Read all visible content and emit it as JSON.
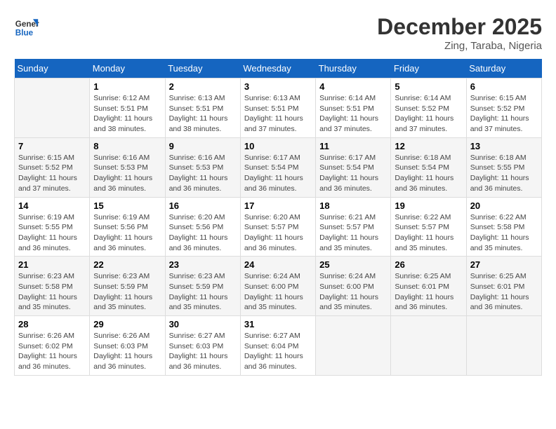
{
  "header": {
    "logo_general": "General",
    "logo_blue": "Blue",
    "title": "December 2025",
    "subtitle": "Zing, Taraba, Nigeria"
  },
  "calendar": {
    "days_of_week": [
      "Sunday",
      "Monday",
      "Tuesday",
      "Wednesday",
      "Thursday",
      "Friday",
      "Saturday"
    ],
    "weeks": [
      [
        {
          "day": "",
          "info": ""
        },
        {
          "day": "1",
          "info": "Sunrise: 6:12 AM\nSunset: 5:51 PM\nDaylight: 11 hours and 38 minutes."
        },
        {
          "day": "2",
          "info": "Sunrise: 6:13 AM\nSunset: 5:51 PM\nDaylight: 11 hours and 38 minutes."
        },
        {
          "day": "3",
          "info": "Sunrise: 6:13 AM\nSunset: 5:51 PM\nDaylight: 11 hours and 37 minutes."
        },
        {
          "day": "4",
          "info": "Sunrise: 6:14 AM\nSunset: 5:51 PM\nDaylight: 11 hours and 37 minutes."
        },
        {
          "day": "5",
          "info": "Sunrise: 6:14 AM\nSunset: 5:52 PM\nDaylight: 11 hours and 37 minutes."
        },
        {
          "day": "6",
          "info": "Sunrise: 6:15 AM\nSunset: 5:52 PM\nDaylight: 11 hours and 37 minutes."
        }
      ],
      [
        {
          "day": "7",
          "info": "Sunrise: 6:15 AM\nSunset: 5:52 PM\nDaylight: 11 hours and 37 minutes."
        },
        {
          "day": "8",
          "info": "Sunrise: 6:16 AM\nSunset: 5:53 PM\nDaylight: 11 hours and 36 minutes."
        },
        {
          "day": "9",
          "info": "Sunrise: 6:16 AM\nSunset: 5:53 PM\nDaylight: 11 hours and 36 minutes."
        },
        {
          "day": "10",
          "info": "Sunrise: 6:17 AM\nSunset: 5:54 PM\nDaylight: 11 hours and 36 minutes."
        },
        {
          "day": "11",
          "info": "Sunrise: 6:17 AM\nSunset: 5:54 PM\nDaylight: 11 hours and 36 minutes."
        },
        {
          "day": "12",
          "info": "Sunrise: 6:18 AM\nSunset: 5:54 PM\nDaylight: 11 hours and 36 minutes."
        },
        {
          "day": "13",
          "info": "Sunrise: 6:18 AM\nSunset: 5:55 PM\nDaylight: 11 hours and 36 minutes."
        }
      ],
      [
        {
          "day": "14",
          "info": "Sunrise: 6:19 AM\nSunset: 5:55 PM\nDaylight: 11 hours and 36 minutes."
        },
        {
          "day": "15",
          "info": "Sunrise: 6:19 AM\nSunset: 5:56 PM\nDaylight: 11 hours and 36 minutes."
        },
        {
          "day": "16",
          "info": "Sunrise: 6:20 AM\nSunset: 5:56 PM\nDaylight: 11 hours and 36 minutes."
        },
        {
          "day": "17",
          "info": "Sunrise: 6:20 AM\nSunset: 5:57 PM\nDaylight: 11 hours and 36 minutes."
        },
        {
          "day": "18",
          "info": "Sunrise: 6:21 AM\nSunset: 5:57 PM\nDaylight: 11 hours and 35 minutes."
        },
        {
          "day": "19",
          "info": "Sunrise: 6:22 AM\nSunset: 5:57 PM\nDaylight: 11 hours and 35 minutes."
        },
        {
          "day": "20",
          "info": "Sunrise: 6:22 AM\nSunset: 5:58 PM\nDaylight: 11 hours and 35 minutes."
        }
      ],
      [
        {
          "day": "21",
          "info": "Sunrise: 6:23 AM\nSunset: 5:58 PM\nDaylight: 11 hours and 35 minutes."
        },
        {
          "day": "22",
          "info": "Sunrise: 6:23 AM\nSunset: 5:59 PM\nDaylight: 11 hours and 35 minutes."
        },
        {
          "day": "23",
          "info": "Sunrise: 6:23 AM\nSunset: 5:59 PM\nDaylight: 11 hours and 35 minutes."
        },
        {
          "day": "24",
          "info": "Sunrise: 6:24 AM\nSunset: 6:00 PM\nDaylight: 11 hours and 35 minutes."
        },
        {
          "day": "25",
          "info": "Sunrise: 6:24 AM\nSunset: 6:00 PM\nDaylight: 11 hours and 35 minutes."
        },
        {
          "day": "26",
          "info": "Sunrise: 6:25 AM\nSunset: 6:01 PM\nDaylight: 11 hours and 36 minutes."
        },
        {
          "day": "27",
          "info": "Sunrise: 6:25 AM\nSunset: 6:01 PM\nDaylight: 11 hours and 36 minutes."
        }
      ],
      [
        {
          "day": "28",
          "info": "Sunrise: 6:26 AM\nSunset: 6:02 PM\nDaylight: 11 hours and 36 minutes."
        },
        {
          "day": "29",
          "info": "Sunrise: 6:26 AM\nSunset: 6:03 PM\nDaylight: 11 hours and 36 minutes."
        },
        {
          "day": "30",
          "info": "Sunrise: 6:27 AM\nSunset: 6:03 PM\nDaylight: 11 hours and 36 minutes."
        },
        {
          "day": "31",
          "info": "Sunrise: 6:27 AM\nSunset: 6:04 PM\nDaylight: 11 hours and 36 minutes."
        },
        {
          "day": "",
          "info": ""
        },
        {
          "day": "",
          "info": ""
        },
        {
          "day": "",
          "info": ""
        }
      ]
    ]
  }
}
